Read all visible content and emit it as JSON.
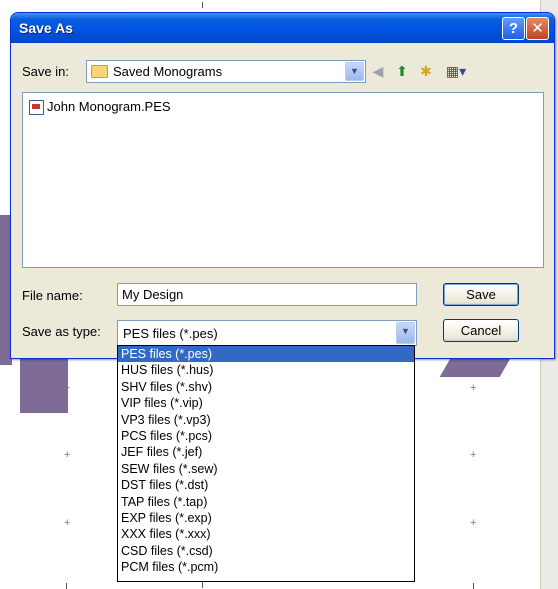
{
  "dialog": {
    "title": "Save As",
    "help_icon_glyph": "?",
    "close_icon_glyph": "✕",
    "save_in_label": "Save in:",
    "save_in_value": "Saved Monograms",
    "file_name_label": "File name:",
    "file_name_value": "My Design",
    "save_as_type_label": "Save as type:",
    "save_as_type_value": "PES files (*.pes)",
    "save_button": "Save",
    "cancel_button": "Cancel"
  },
  "files": [
    "John Monogram.PES"
  ],
  "type_options": [
    "PES files (*.pes)",
    "HUS files (*.hus)",
    "SHV files (*.shv)",
    "VIP files (*.vip)",
    "VP3 files (*.vp3)",
    "PCS files (*.pcs)",
    "JEF files (*.jef)",
    "SEW files (*.sew)",
    "DST files (*.dst)",
    "TAP files (*.tap)",
    "EXP files (*.exp)",
    "XXX files (*.xxx)",
    "CSD files (*.csd)",
    "PCM files (*.pcm)"
  ],
  "selected_option_index": 0,
  "colors": {
    "title_bar": "#0054e3",
    "selection": "#316ac5",
    "dialog_face": "#ece9d8"
  },
  "icons": [
    "help-icon",
    "close-icon",
    "folder-icon",
    "back-icon",
    "up-folder-icon",
    "new-folder-icon",
    "views-menu-icon",
    "dropdown-arrow-icon",
    "pes-file-icon"
  ]
}
